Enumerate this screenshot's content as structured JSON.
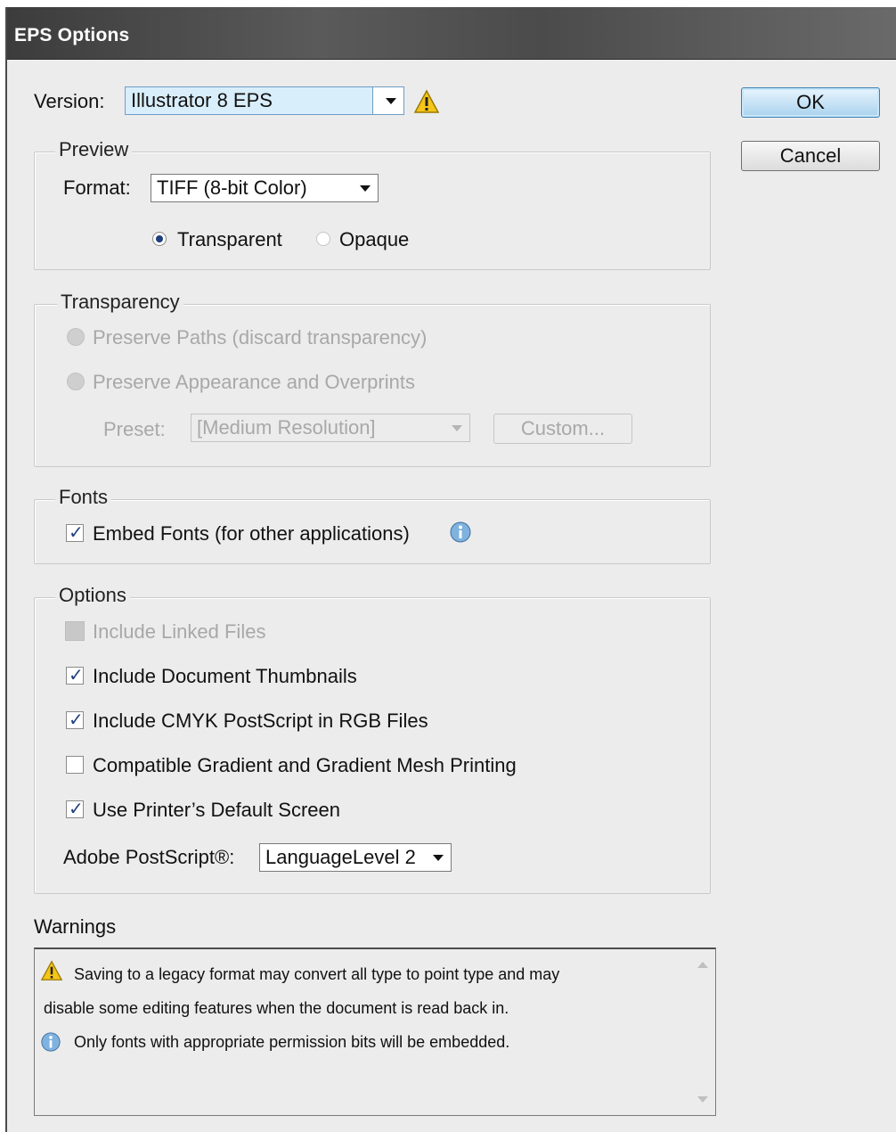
{
  "window": {
    "title": "EPS Options"
  },
  "version": {
    "label": "Version:",
    "value": "Illustrator 8 EPS"
  },
  "buttons": {
    "ok": "OK",
    "cancel": "Cancel"
  },
  "preview": {
    "legend": "Preview",
    "format_label": "Format:",
    "format_value": "TIFF (8-bit Color)",
    "transparent": "Transparent",
    "opaque": "Opaque",
    "selected": "Transparent"
  },
  "transparency": {
    "legend": "Transparency",
    "preserve_paths": "Preserve Paths (discard transparency)",
    "preserve_appearance": "Preserve Appearance and Overprints",
    "preset_label": "Preset:",
    "preset_value": "[Medium Resolution]",
    "custom_button": "Custom..."
  },
  "fonts": {
    "legend": "Fonts",
    "embed_label": "Embed Fonts (for other applications)",
    "embed_checked": true
  },
  "options": {
    "legend": "Options",
    "items": [
      {
        "label": "Include Linked Files",
        "checked": false,
        "enabled": false
      },
      {
        "label": "Include Document Thumbnails",
        "checked": true,
        "enabled": true
      },
      {
        "label": "Include CMYK PostScript in RGB Files",
        "checked": true,
        "enabled": true
      },
      {
        "label": "Compatible Gradient and Gradient Mesh Printing",
        "checked": false,
        "enabled": true
      },
      {
        "label": "Use Printer’s Default Screen",
        "checked": true,
        "enabled": true
      }
    ],
    "postscript_label": "Adobe PostScript®:",
    "postscript_value": "LanguageLevel 2"
  },
  "warnings": {
    "label": "Warnings",
    "lines": [
      "Saving to a legacy format may convert all type to point type and may",
      "disable some editing features when the document is read back in.",
      "Only fonts with appropriate permission bits will be embedded."
    ]
  }
}
